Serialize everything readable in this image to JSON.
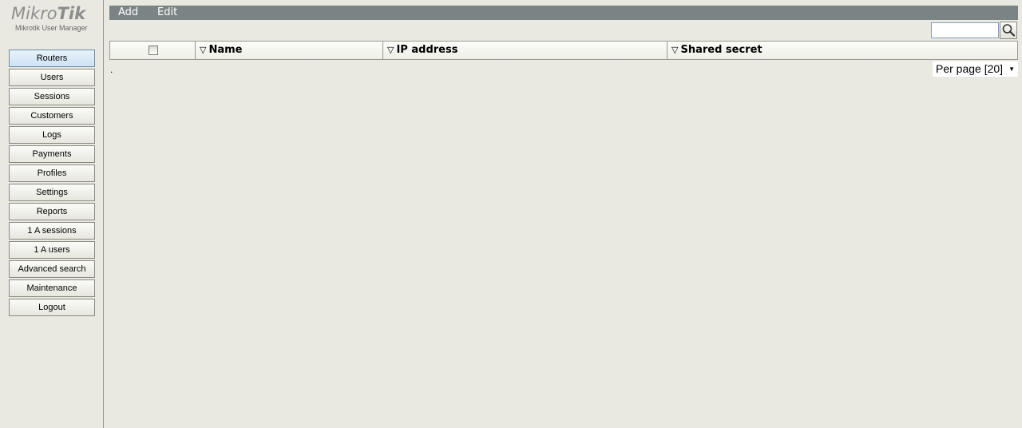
{
  "logo": {
    "brand_light": "Mikro",
    "brand_bold": "Tik",
    "subtitle": "Mikrotik User Manager"
  },
  "nav": {
    "items": [
      {
        "label": "Routers",
        "active": true
      },
      {
        "label": "Users"
      },
      {
        "label": "Sessions"
      },
      {
        "label": "Customers"
      },
      {
        "label": "Logs"
      },
      {
        "label": "Payments"
      },
      {
        "label": "Profiles"
      },
      {
        "label": "Settings"
      },
      {
        "label": "Reports"
      },
      {
        "label": "1 A sessions"
      },
      {
        "label": "1 A users"
      },
      {
        "label": "Advanced search"
      },
      {
        "label": "Maintenance"
      },
      {
        "label": "Logout"
      }
    ]
  },
  "toolbar": {
    "add_label": "Add",
    "edit_label": "Edit"
  },
  "search": {
    "value": "",
    "icon": "search-icon"
  },
  "table": {
    "columns": {
      "name": "Name",
      "ip": "IP address",
      "secret": "Shared secret"
    },
    "sort_glyph": "▽",
    "empty_marker": "."
  },
  "pagination": {
    "per_page_label": "Per page [20]"
  },
  "colors": {
    "background": "#e9e9e1",
    "toolbar": "#7a8484",
    "active_nav": "#cfe3f5"
  }
}
